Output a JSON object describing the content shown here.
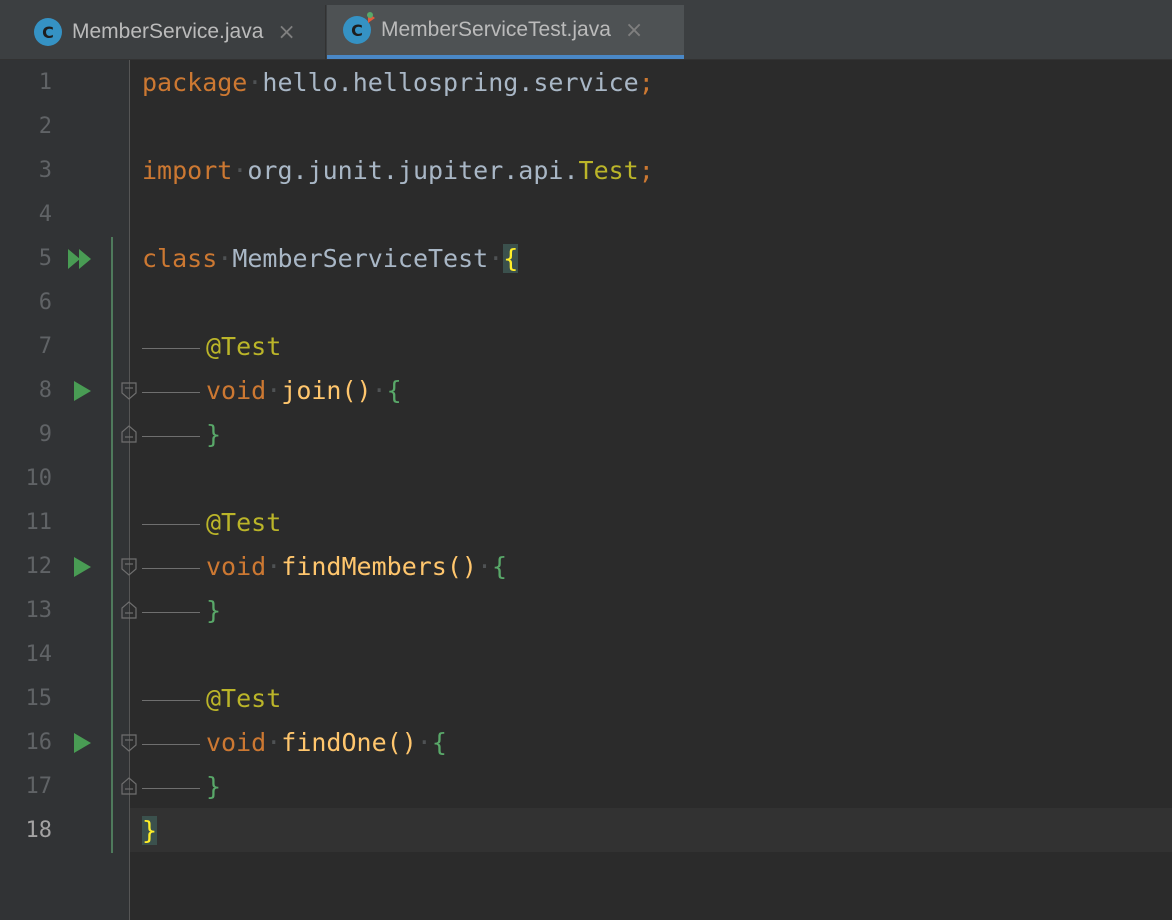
{
  "tabs": [
    {
      "icon": "java-class-icon",
      "label": "MemberService.java",
      "close": "×",
      "active": false
    },
    {
      "icon": "java-test-class-icon",
      "label": "MemberServiceTest.java",
      "close": "×",
      "active": true
    }
  ],
  "icon_letter": "C",
  "line_numbers": [
    "1",
    "2",
    "3",
    "4",
    "5",
    "6",
    "7",
    "8",
    "9",
    "10",
    "11",
    "12",
    "13",
    "14",
    "15",
    "16",
    "17",
    "18"
  ],
  "current_line": "18",
  "code": {
    "l1": {
      "keyword": "package",
      "rest": "hello.hellospring.service",
      "semi": ";"
    },
    "l3": {
      "keyword": "import",
      "pkg": "org.junit.jupiter.api.",
      "cls": "Test",
      "semi": ";"
    },
    "l5": {
      "keyword": "class",
      "name": "MemberServiceTest",
      "brace": "{"
    },
    "l7": {
      "annotation": "@Test"
    },
    "l8": {
      "keyword": "void",
      "method": "join",
      "parens": "()",
      "brace": "{"
    },
    "l9": {
      "brace": "}"
    },
    "l11": {
      "annotation": "@Test"
    },
    "l12": {
      "keyword": "void",
      "method": "findMembers",
      "parens": "()",
      "brace": "{"
    },
    "l13": {
      "brace": "}"
    },
    "l15": {
      "annotation": "@Test"
    },
    "l16": {
      "keyword": "void",
      "method": "findOne",
      "parens": "()",
      "brace": "{"
    },
    "l17": {
      "brace": "}"
    },
    "l18": {
      "brace": "}"
    }
  },
  "gutter_icons": {
    "class_run": "run-all-tests-icon",
    "method_run": "run-test-icon",
    "fold": "fold-marker-icon"
  },
  "colors": {
    "keyword": "#cc7832",
    "annotation": "#bbb529",
    "method": "#ffc66d",
    "text": "#a9b7c6",
    "run": "#499c54",
    "tab_underline": "#4a88c7"
  }
}
